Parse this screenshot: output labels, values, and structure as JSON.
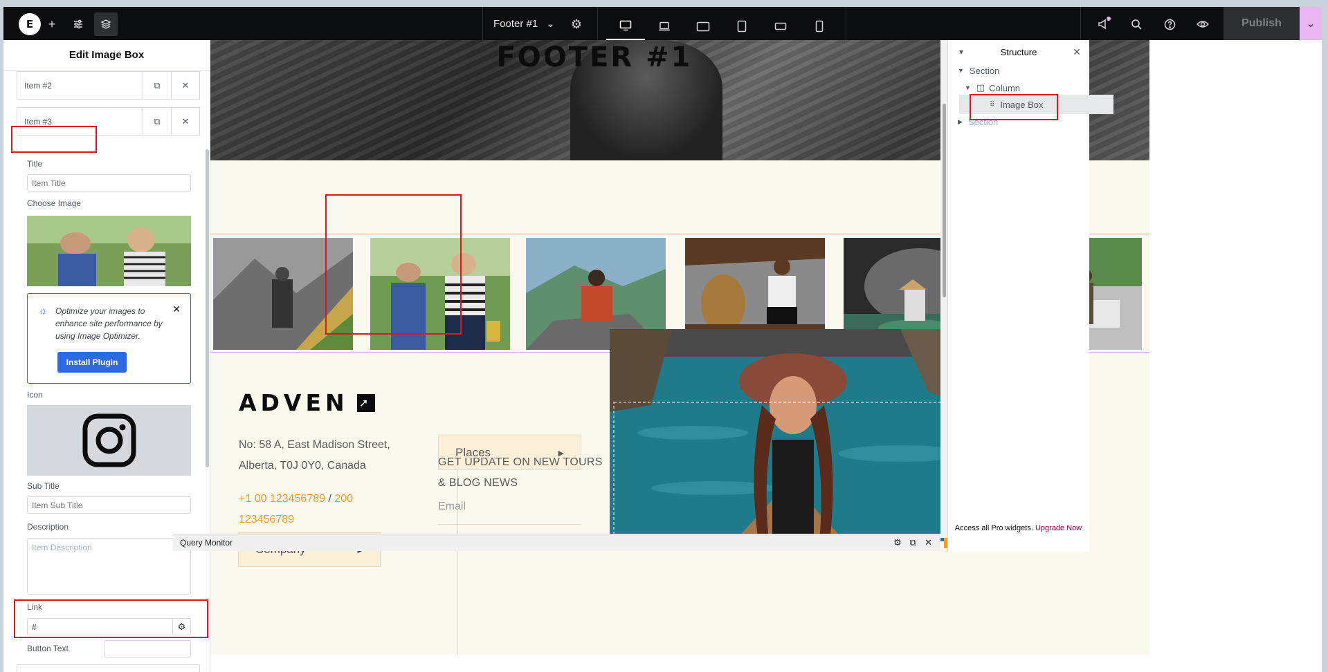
{
  "topbar": {
    "logo": "E",
    "document_title": "Footer #1",
    "publish_label": "Publish"
  },
  "left_panel": {
    "title": "Edit Image Box",
    "items": [
      {
        "label": "Item #2"
      },
      {
        "label": "Item #3"
      }
    ],
    "title_label": "Title",
    "title_placeholder": "Item Title",
    "choose_image_label": "Choose Image",
    "notice": {
      "text": "Optimize your images to enhance site performance by using Image Optimizer.",
      "button": "Install Plugin"
    },
    "icon_label": "Icon",
    "icon_name": "instagram-icon",
    "subtitle_label": "Sub Title",
    "subtitle_placeholder": "Item Sub Title",
    "description_label": "Description",
    "description_placeholder": "Item Description",
    "link_label": "Link",
    "link_value": "#",
    "button_text_label": "Button Text"
  },
  "canvas": {
    "hero_title": "FOOTER #1",
    "brand": "ADVEN",
    "address": "No: 58 A, East Madison Street, Alberta, T0J 0Y0, Canada",
    "phone_1": "+1 00 123456789",
    "phone_sep": "/",
    "phone_2": "200 123456789",
    "company_label": "Company",
    "places_label": "Places",
    "newsletter": "GET UPDATE ON NEW TOURS & BLOG NEWS",
    "email_placeholder": "Email"
  },
  "query_monitor": {
    "label": "Query Monitor"
  },
  "right_panel": {
    "title": "Structure",
    "tree": [
      {
        "label": "Section"
      },
      {
        "label": "Column"
      },
      {
        "label": "Image Box"
      },
      {
        "label": "Section"
      }
    ],
    "footer_text": "Access all Pro widgets.",
    "upgrade_link": "Upgrade Now"
  },
  "colors": {
    "accent_orange": "#f39a2e",
    "primary_blue": "#2d6ae0",
    "highlight_red": "#e0161f",
    "upgrade_link": "#93003f"
  }
}
